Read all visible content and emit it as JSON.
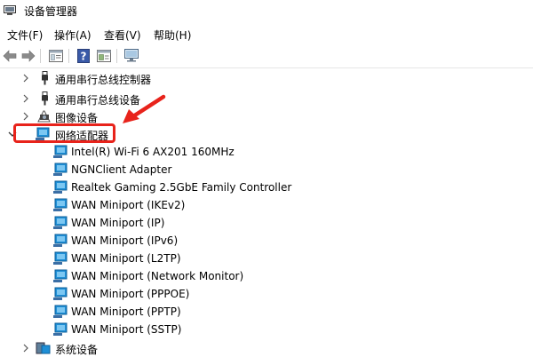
{
  "window": {
    "title": "设备管理器",
    "icon": "device-manager-icon"
  },
  "menu": [
    {
      "label": "文件(F)"
    },
    {
      "label": "操作(A)"
    },
    {
      "label": "查看(V)"
    },
    {
      "label": "帮助(H)"
    }
  ],
  "toolbar": {
    "buttons": [
      "back-arrow-icon",
      "forward-arrow-icon",
      "properties-icon",
      "help-icon",
      "view-icon",
      "monitor-icon"
    ]
  },
  "tree": {
    "above": [
      {
        "label": "通用串行总线控制器",
        "icon": "usb-icon",
        "expanded": false
      },
      {
        "label": "通用串行总线设备",
        "icon": "usb-icon",
        "expanded": false
      },
      {
        "label": "图像设备",
        "icon": "camera-icon",
        "expanded": false
      }
    ],
    "network_adapters": {
      "label": "网络适配器",
      "icon": "network-adapter-icon",
      "expanded": true,
      "children": [
        {
          "label": "Intel(R) Wi-Fi 6 AX201 160MHz"
        },
        {
          "label": "NGNClient Adapter"
        },
        {
          "label": "Realtek Gaming 2.5GbE Family Controller"
        },
        {
          "label": "WAN Miniport (IKEv2)"
        },
        {
          "label": "WAN Miniport (IP)"
        },
        {
          "label": "WAN Miniport (IPv6)"
        },
        {
          "label": "WAN Miniport (L2TP)"
        },
        {
          "label": "WAN Miniport (Network Monitor)"
        },
        {
          "label": "WAN Miniport (PPPOE)"
        },
        {
          "label": "WAN Miniport (PPTP)"
        },
        {
          "label": "WAN Miniport (SSTP)"
        }
      ]
    },
    "below": [
      {
        "label": "系统设备",
        "icon": "system-device-icon",
        "expanded": false
      }
    ]
  },
  "annotation": {
    "color": "#e8231b"
  }
}
